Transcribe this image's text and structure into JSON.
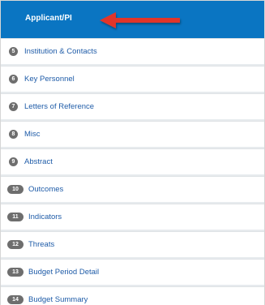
{
  "header": {
    "label": "Applicant/PI",
    "accent_color": "#0a75c2",
    "arrow_color": "#e0342c"
  },
  "nav_items": [
    {
      "number": "5",
      "label": "Institution & Contacts"
    },
    {
      "number": "6",
      "label": "Key Personnel"
    },
    {
      "number": "7",
      "label": "Letters of Reference"
    },
    {
      "number": "8",
      "label": "Misc"
    },
    {
      "number": "9",
      "label": "Abstract"
    },
    {
      "number": "10",
      "label": "Outcomes"
    },
    {
      "number": "11",
      "label": "Indicators"
    },
    {
      "number": "12",
      "label": "Threats"
    },
    {
      "number": "13",
      "label": "Budget Period Detail"
    },
    {
      "number": "14",
      "label": "Budget Summary"
    }
  ]
}
